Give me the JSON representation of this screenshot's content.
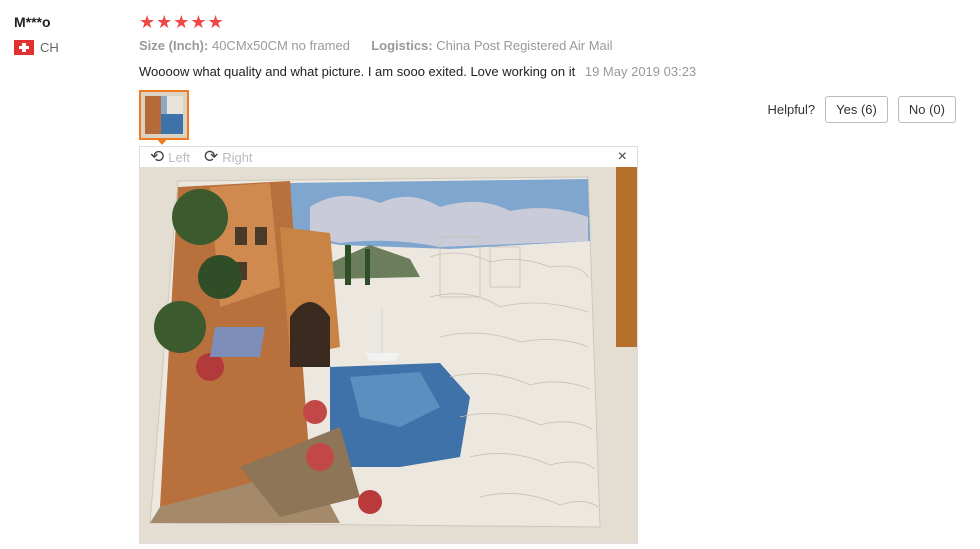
{
  "reviewer": {
    "name": "M***o",
    "country": "CH"
  },
  "rating": {
    "stars": 5,
    "glyph": "★★★★★",
    "color": "#f04747"
  },
  "attributes": {
    "size_label": "Size (Inch):",
    "size_value": "40CMx50CM no framed",
    "logistics_label": "Logistics:",
    "logistics_value": "China Post Registered Air Mail"
  },
  "review": {
    "text": "Woooow what quality and what picture. I am sooo exited. Love working on it",
    "date": "19 May 2019 03:23"
  },
  "helpful": {
    "label": "Helpful?",
    "yes": "Yes (6)",
    "no": "No (0)"
  },
  "viewer": {
    "rotate_left": "Left",
    "rotate_right": "Right",
    "close": "×",
    "rotate_left_icon": "rotate-left-icon",
    "rotate_right_icon": "rotate-right-icon"
  },
  "colors": {
    "accent": "#f07a1f",
    "star": "#f04747"
  }
}
